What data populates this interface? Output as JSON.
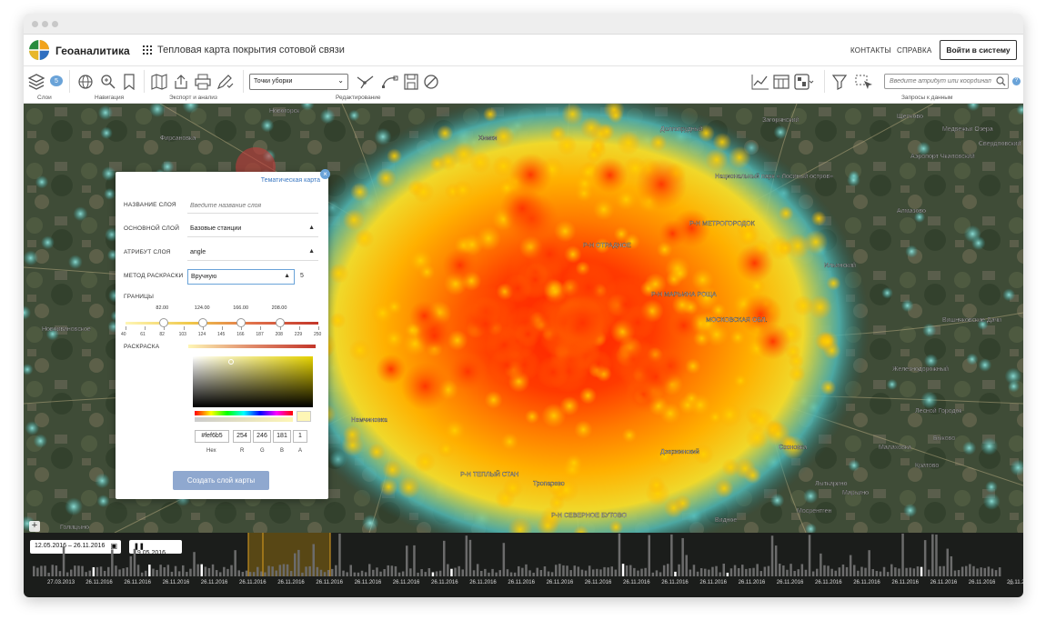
{
  "app": {
    "name": "Геоаналитика",
    "page_title": "Тепловая карта покрытия сотовой связи"
  },
  "nav": {
    "contacts": "КОНТАКТЫ",
    "help": "СПРАВКА",
    "login": "Войти в систему"
  },
  "toolbar": {
    "groups": {
      "layers": "Слои",
      "navigation": "Навигация",
      "export": "Экспорт и анализ",
      "editing": "Редактирование",
      "queries": "Запросы к данным"
    },
    "layers_badge": "5",
    "layer_select": "Точки уборки",
    "search_placeholder": "Введите атрибут или координаты"
  },
  "map": {
    "labels": [
      "Загорянский",
      "Щелково",
      "Медвежьи Озера",
      "Свердловский",
      "Аэропорт Чкаловский",
      "Р-Н МЕТРОГОРОДОК",
      "Национальный парк « Лосиный остров»",
      "Алмазово",
      "Р-Н МАРЬИНА РОЩА",
      "Р-Н ОТРАДНОЕ",
      "МОСКОВСКАЯ ОБЛ.",
      "Железнодорожный",
      "Лыткарино",
      "Дзержинский",
      "Р-Н ТЕПЛЫЙ СТАН",
      "Р-Н СЕВЕРНОЕ БУТОВО",
      "Видное",
      "Мосрентген",
      "Горки-10",
      "Лесной Городок",
      "Фирсановка",
      "Химки",
      "Долгопрудный",
      "Вишняковские Дачи",
      "Малаховка",
      "Сосновка",
      "Новоивановское",
      "Марьино",
      "Тропарево",
      "Ромашково",
      "Голицыно",
      "Власиха",
      "Немчиновка",
      "Одинцово",
      "Новогорск",
      "Кратово",
      "Быково",
      "Ильинский"
    ]
  },
  "panel": {
    "thematic_link": "Тематическая карта",
    "name_label": "НАЗВАНИЕ СЛОЯ",
    "name_placeholder": "Введите название слоя",
    "base_label": "ОСНОВНОЙ СЛОЙ",
    "base_value": "Базовые станции",
    "attr_label": "АТРИБУТ СЛОЯ",
    "attr_value": "angle",
    "method_label": "МЕТОД РАСКРАСКИ",
    "method_value": "Вручную",
    "classes": "5",
    "bounds_label": "ГРАНИЦЫ",
    "handles": [
      "82.00",
      "124.00",
      "166.00",
      "208.00"
    ],
    "ticks": [
      "40",
      "61",
      "82",
      "103",
      "124",
      "145",
      "166",
      "187",
      "208",
      "229",
      "250"
    ],
    "color_label": "РАСКРАСКА",
    "hex": "#fef6b5",
    "r": "254",
    "g": "246",
    "b": "181",
    "a": "1",
    "hex_label": "Hex",
    "r_label": "R",
    "g_label": "G",
    "b_label": "B",
    "a_label": "A",
    "create_button": "Создать слой карты"
  },
  "timeline": {
    "range": "12.05.2016 – 26.11.2016",
    "current": "19.05.2016",
    "dates": [
      "27.03.2013",
      "26.11.2016",
      "26.11.2016",
      "26.11.2016",
      "26.11.2016",
      "26.11.2016",
      "26.11.2016",
      "26.11.2016",
      "26.11.2016",
      "26.11.2016",
      "26.11.2016",
      "26.11.2016",
      "26.11.2016",
      "26.11.2016",
      "26.11.2016",
      "26.11.2016",
      "26.11.2016",
      "26.11.2016",
      "26.11.2016",
      "26.11.2016",
      "26.11.2016",
      "26.11.2016",
      "26.11.2016",
      "26.11.2016",
      "26.11.2016",
      "26.11.2016"
    ]
  },
  "colors": {
    "accent": "#3a78c2",
    "button": "#8fa8cf",
    "heat_core": "#ff2a00",
    "heat_mid": "#ffa500",
    "heat_edge": "#ffe83a",
    "teal": "#58c7c7"
  }
}
